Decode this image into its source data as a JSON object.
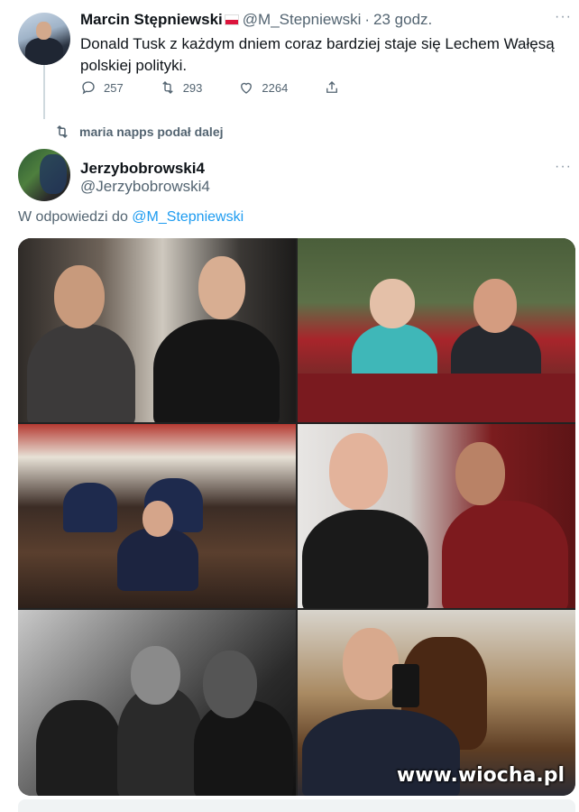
{
  "tweet1": {
    "name": "Marcin Stępniewski",
    "handle": "@M_Stepniewski",
    "separator": "·",
    "time": "23 godz.",
    "text": "Donald Tusk z każdym dniem coraz bardziej staje się Lechem Wałęsą polskiej polityki.",
    "actions": {
      "reply_count": "257",
      "retweet_count": "293",
      "like_count": "2264"
    },
    "more_label": "···"
  },
  "retweet_banner": {
    "text": "maria napps podał dalej"
  },
  "tweet2": {
    "name": "Jerzybobrowski4",
    "handle": "@Jerzybobrowski4",
    "more_label": "···",
    "reply_prefix": "W odpowiedzi do ",
    "reply_mention": "@M_Stepniewski",
    "photos": [
      "photo-1",
      "photo-2",
      "photo-3",
      "photo-4",
      "photo-5",
      "photo-6"
    ]
  },
  "watermark": "www.wiocha.pl",
  "icons": {
    "reply": "reply-icon",
    "retweet": "retweet-icon",
    "like": "heart-icon",
    "share": "share-icon"
  },
  "colors": {
    "link": "#1d9bf0",
    "secondary_text": "#536471",
    "primary_text": "#0f1419"
  }
}
